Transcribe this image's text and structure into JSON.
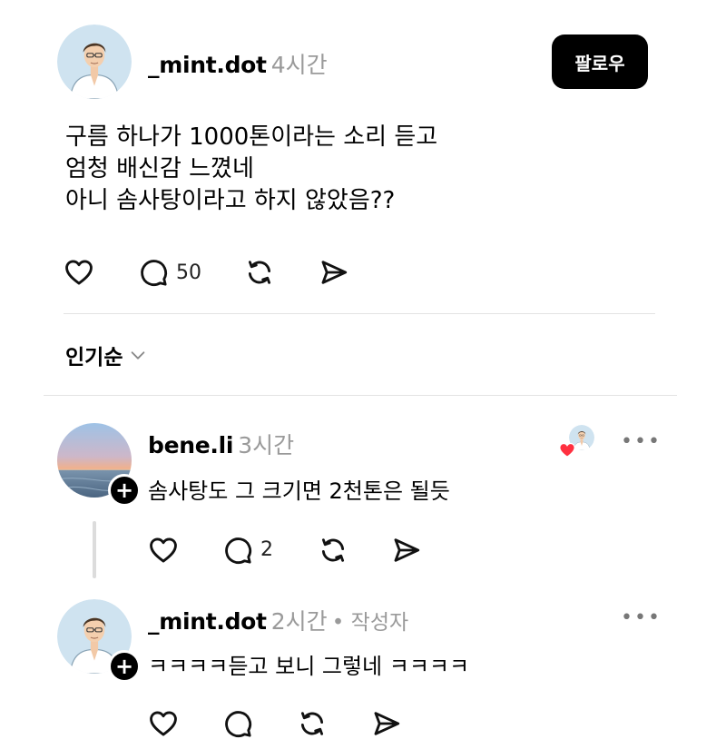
{
  "post": {
    "username": "_mint.dot",
    "time": "4시간",
    "follow_label": "팔로우",
    "lines": [
      "구름 하나가 1000톤이라는 소리 듣고",
      "엄청 배신감 느꼈네",
      "아니 솜사탕이라고 하지 않았음??"
    ],
    "reply_count": "50"
  },
  "sort": {
    "label": "인기순"
  },
  "comments": [
    {
      "username": "bene.li",
      "time": "3시간",
      "text": "솜사탕도 그 크기면 2천톤은 될듯",
      "reply_count": "2",
      "more": "•••"
    },
    {
      "username": "_mint.dot",
      "time": "2시간",
      "author_tag": "• 작성자",
      "text": "ㅋㅋㅋㅋ듣고 보니 그렇네 ㅋㅋㅋㅋ",
      "more": "•••"
    }
  ],
  "colors": {
    "heart": "#ff3040",
    "muted": "#9a9a9a"
  },
  "icons": [
    "heart-icon",
    "comment-icon",
    "repost-icon",
    "share-icon",
    "chevron-down-icon",
    "plus-icon",
    "more-icon"
  ]
}
